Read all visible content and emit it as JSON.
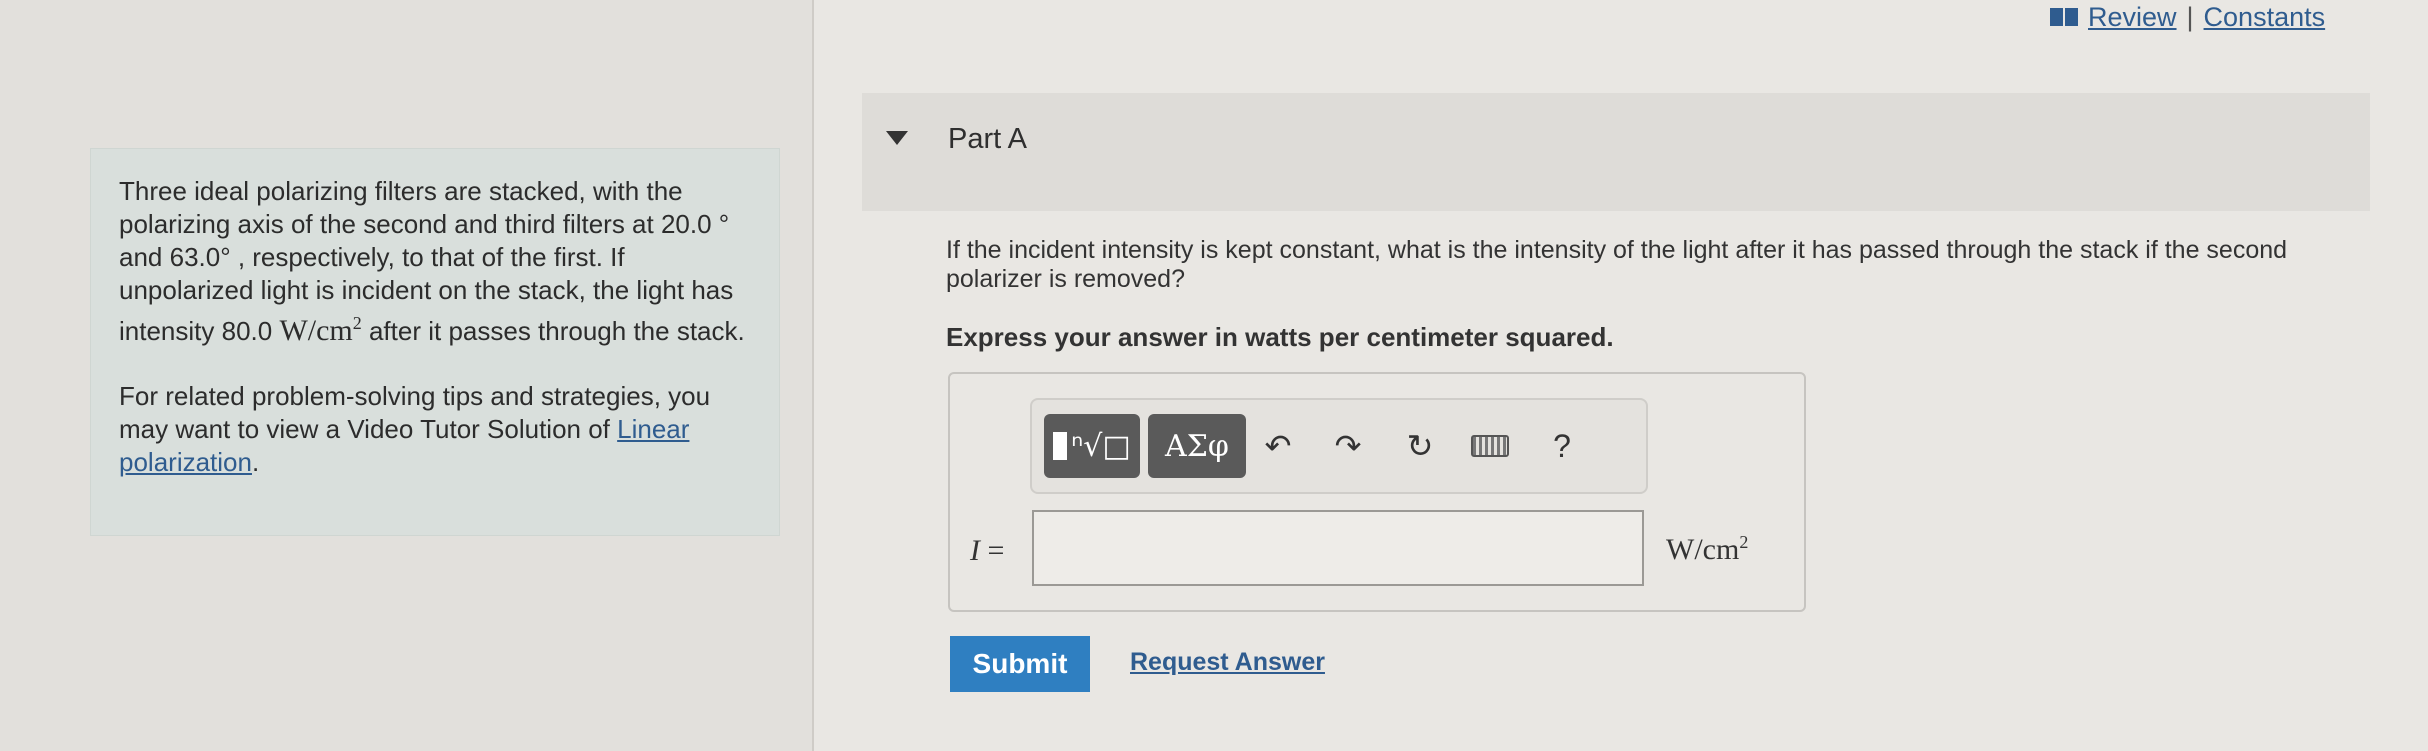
{
  "header": {
    "review_label": "Review",
    "separator": "|",
    "constants_label": "Constants",
    "icon": "book-icon"
  },
  "problem": {
    "text_1": "Three ideal polarizing filters are stacked, with the polarizing axis of the second and third filters at 20.0 ° and 63.0° , respectively, to that of the first. If unpolarized light is incident on the stack, the light has intensity 80.0 ",
    "unit_base": "W/cm",
    "unit_exp": "2",
    "text_2": " after it passes through the stack.",
    "tips_text": "For related problem-solving tips and strategies, you may want to view a Video Tutor Solution of ",
    "tips_link": "Linear polarization",
    "tips_end": "."
  },
  "part": {
    "title": "Part A",
    "question": "If the incident intensity is kept constant, what is the intensity of the light after it has passed through the stack if the second polarizer is removed?",
    "instruction": "Express your answer in watts per centimeter squared."
  },
  "toolbar": {
    "templates_symbol": "ⁿ√□",
    "greek_label": "ΑΣφ",
    "undo_symbol": "↶",
    "redo_symbol": "↷",
    "reset_symbol": "↻",
    "help_label": "?"
  },
  "answer": {
    "variable": "I",
    "equals": "=",
    "value": "",
    "unit_base": "W/cm",
    "unit_exp": "2"
  },
  "actions": {
    "submit_label": "Submit",
    "request_label": "Request Answer"
  }
}
